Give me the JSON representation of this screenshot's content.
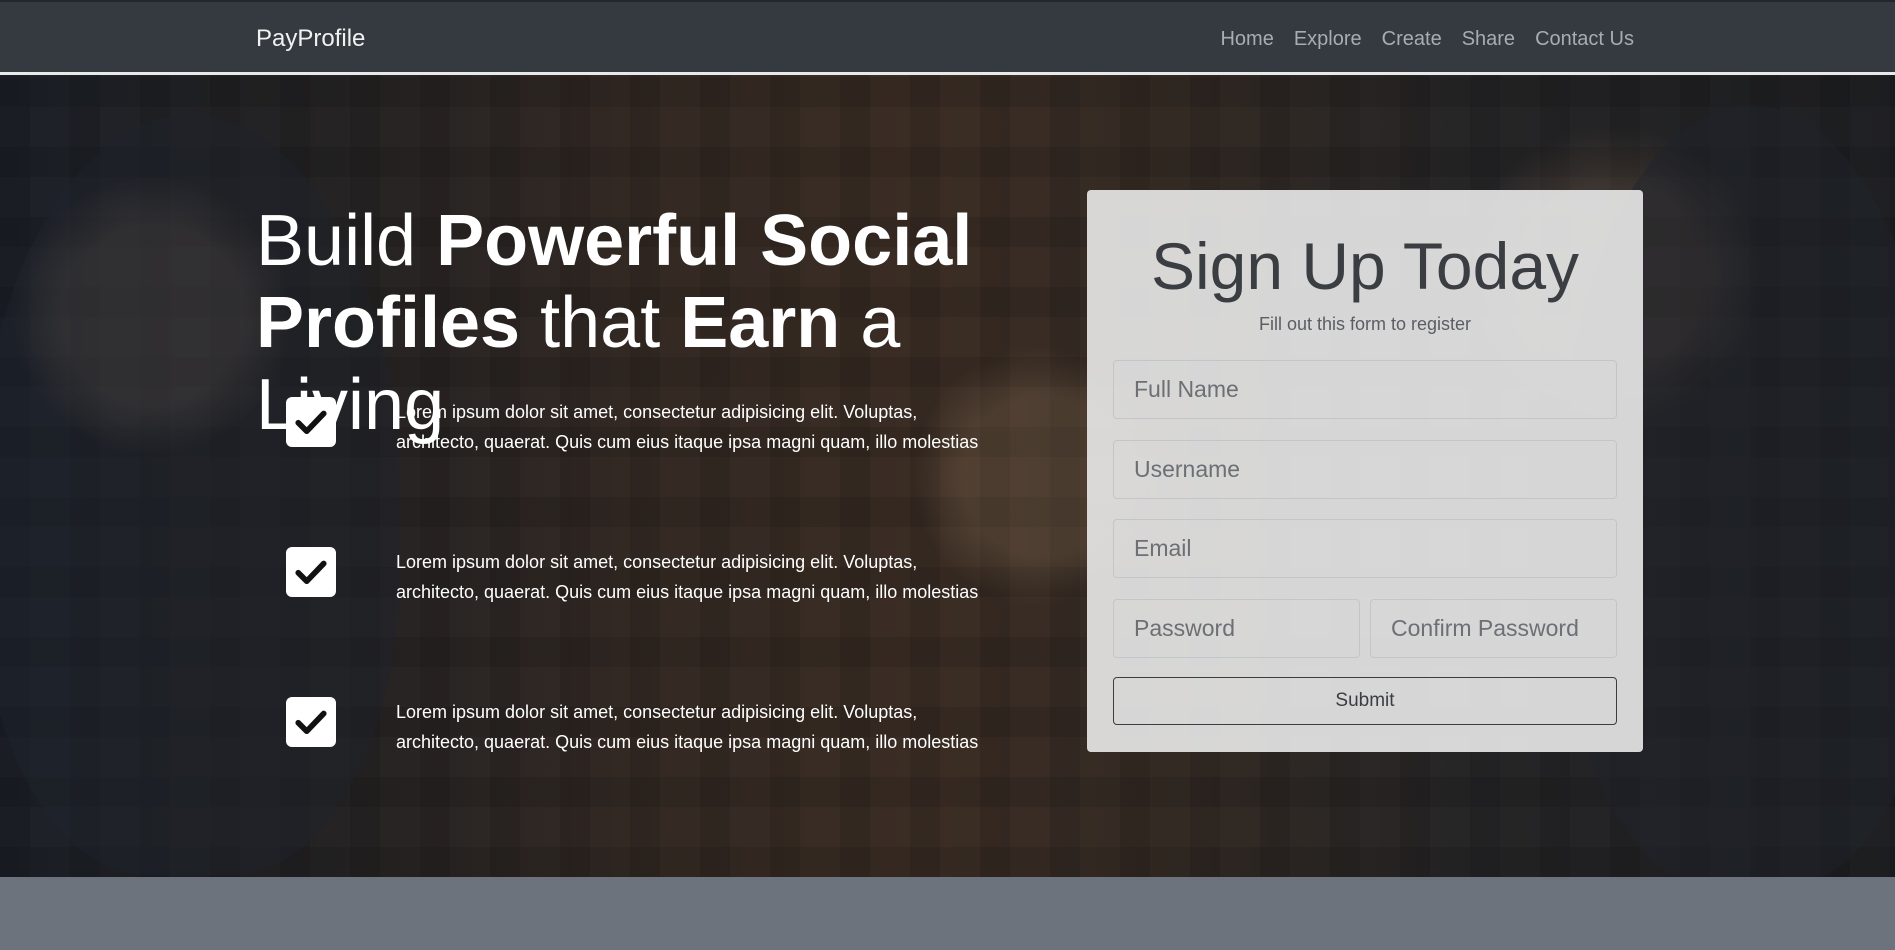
{
  "navbar": {
    "brand": "PayProfile",
    "links": [
      "Home",
      "Explore",
      "Create",
      "Share",
      "Contact Us"
    ]
  },
  "hero": {
    "headline": {
      "part1": "Build ",
      "part2": "Powerful Social",
      "part3": "Profiles",
      "part4": " that ",
      "part5": "Earn",
      "part6": " a Living"
    },
    "features": [
      {
        "icon": "check-icon",
        "text": "Lorem ipsum dolor sit amet, consectetur adipisicing elit. Voluptas, architecto, quaerat. Quis cum eius itaque ipsa magni quam, illo molestias"
      },
      {
        "icon": "check-icon",
        "text": "Lorem ipsum dolor sit amet, consectetur adipisicing elit. Voluptas, architecto, quaerat. Quis cum eius itaque ipsa magni quam, illo molestias"
      },
      {
        "icon": "check-icon",
        "text": "Lorem ipsum dolor sit amet, consectetur adipisicing elit. Voluptas, architecto, quaerat. Quis cum eius itaque ipsa magni quam, illo molestias"
      }
    ]
  },
  "signup": {
    "title": "Sign Up Today",
    "subtitle": "Fill out this form to register",
    "fields": {
      "full_name": "Full Name",
      "username": "Username",
      "email": "Email",
      "password": "Password",
      "confirm_password": "Confirm Password"
    },
    "submit_label": "Submit"
  },
  "colors": {
    "navbar_bg": "#343a40",
    "footer_band": "#6c737c",
    "card_bg": "#e6e6e6"
  }
}
